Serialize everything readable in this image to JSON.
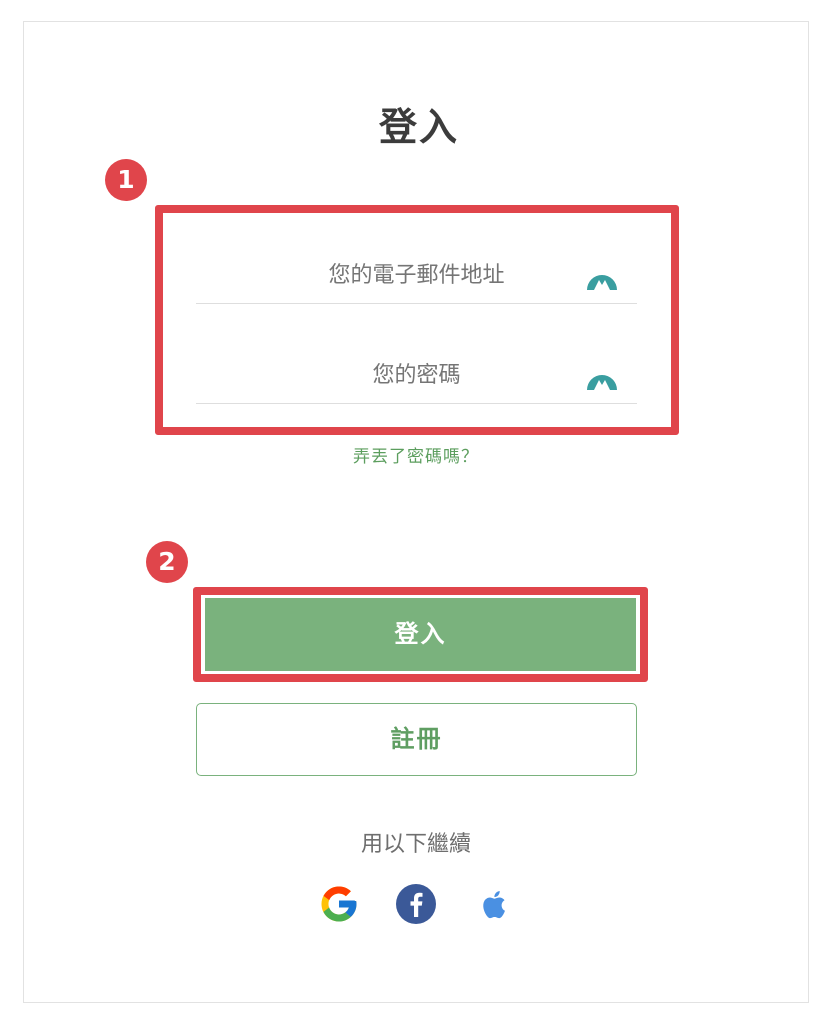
{
  "login": {
    "title": "登入",
    "email_placeholder": "您的電子郵件地址",
    "password_placeholder": "您的密碼",
    "forgot_password": "弄丟了密碼嗎？",
    "login_button": "登入",
    "register_button": "註冊",
    "continue_with": "用以下繼續"
  },
  "annotations": {
    "step1": "1",
    "step2": "2"
  },
  "icons": {
    "field_icon": "nordpass-key-icon",
    "social": [
      "google-icon",
      "facebook-icon",
      "apple-icon"
    ]
  },
  "colors": {
    "accent_green": "#7ab27d",
    "highlight_red": "#e0454b",
    "icon_teal": "#3a9ea0",
    "facebook_blue": "#3b5998",
    "apple_blue": "#4a90e2"
  }
}
